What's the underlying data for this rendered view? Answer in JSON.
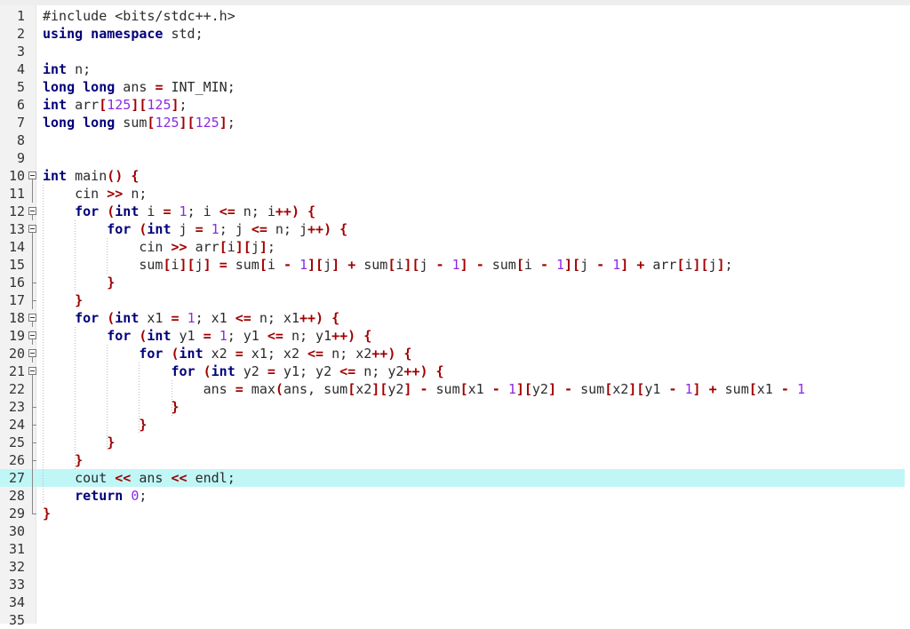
{
  "editor": {
    "highlighted_line": 27,
    "colors": {
      "keyword": "#00007a",
      "number": "#8a2be2",
      "operator": "#a00000",
      "highlight": "#c0f6f6"
    },
    "lines": [
      {
        "num": "1",
        "fold": "",
        "tokens": [
          [
            "c",
            "#include <bits/stdc++.h>"
          ]
        ]
      },
      {
        "num": "2",
        "fold": "",
        "tokens": [
          [
            "k",
            "using namespace"
          ],
          [
            "c",
            " std;"
          ]
        ]
      },
      {
        "num": "3",
        "fold": "",
        "tokens": []
      },
      {
        "num": "4",
        "fold": "",
        "tokens": [
          [
            "k",
            "int"
          ],
          [
            "c",
            " n;"
          ]
        ]
      },
      {
        "num": "5",
        "fold": "",
        "tokens": [
          [
            "k",
            "long long"
          ],
          [
            "c",
            " ans "
          ],
          [
            "p",
            "="
          ],
          [
            "c",
            " INT_MIN;"
          ]
        ]
      },
      {
        "num": "6",
        "fold": "",
        "tokens": [
          [
            "k",
            "int"
          ],
          [
            "c",
            " arr"
          ],
          [
            "p",
            "["
          ],
          [
            "n",
            "125"
          ],
          [
            "p",
            "]["
          ],
          [
            "n",
            "125"
          ],
          [
            "p",
            "]"
          ],
          [
            "c",
            ";"
          ]
        ]
      },
      {
        "num": "7",
        "fold": "",
        "tokens": [
          [
            "k",
            "long long"
          ],
          [
            "c",
            " sum"
          ],
          [
            "p",
            "["
          ],
          [
            "n",
            "125"
          ],
          [
            "p",
            "]["
          ],
          [
            "n",
            "125"
          ],
          [
            "p",
            "]"
          ],
          [
            "c",
            ";"
          ]
        ]
      },
      {
        "num": "8",
        "fold": "",
        "tokens": []
      },
      {
        "num": "9",
        "fold": "",
        "tokens": []
      },
      {
        "num": "10",
        "fold": "open",
        "tokens": [
          [
            "k",
            "int"
          ],
          [
            "c",
            " main"
          ],
          [
            "p",
            "()"
          ],
          [
            "c",
            " "
          ],
          [
            "p",
            "{"
          ]
        ]
      },
      {
        "num": "11",
        "fold": "bar",
        "tokens": [
          [
            "c",
            "    cin "
          ],
          [
            "p",
            ">>"
          ],
          [
            "c",
            " n;"
          ]
        ]
      },
      {
        "num": "12",
        "fold": "open",
        "tokens": [
          [
            "c",
            "    "
          ],
          [
            "k",
            "for"
          ],
          [
            "c",
            " "
          ],
          [
            "p",
            "("
          ],
          [
            "k",
            "int"
          ],
          [
            "c",
            " i "
          ],
          [
            "p",
            "="
          ],
          [
            "c",
            " "
          ],
          [
            "n",
            "1"
          ],
          [
            "c",
            "; i "
          ],
          [
            "p",
            "<="
          ],
          [
            "c",
            " n; i"
          ],
          [
            "p",
            "++)"
          ],
          [
            "c",
            " "
          ],
          [
            "p",
            "{"
          ]
        ]
      },
      {
        "num": "13",
        "fold": "open",
        "tokens": [
          [
            "c",
            "        "
          ],
          [
            "k",
            "for"
          ],
          [
            "c",
            " "
          ],
          [
            "p",
            "("
          ],
          [
            "k",
            "int"
          ],
          [
            "c",
            " j "
          ],
          [
            "p",
            "="
          ],
          [
            "c",
            " "
          ],
          [
            "n",
            "1"
          ],
          [
            "c",
            "; j "
          ],
          [
            "p",
            "<="
          ],
          [
            "c",
            " n; j"
          ],
          [
            "p",
            "++)"
          ],
          [
            "c",
            " "
          ],
          [
            "p",
            "{"
          ]
        ]
      },
      {
        "num": "14",
        "fold": "bar",
        "tokens": [
          [
            "c",
            "            cin "
          ],
          [
            "p",
            ">>"
          ],
          [
            "c",
            " arr"
          ],
          [
            "p",
            "["
          ],
          [
            "c",
            "i"
          ],
          [
            "p",
            "]["
          ],
          [
            "c",
            "j"
          ],
          [
            "p",
            "]"
          ],
          [
            "c",
            ";"
          ]
        ]
      },
      {
        "num": "15",
        "fold": "bar",
        "tokens": [
          [
            "c",
            "            sum"
          ],
          [
            "p",
            "["
          ],
          [
            "c",
            "i"
          ],
          [
            "p",
            "]["
          ],
          [
            "c",
            "j"
          ],
          [
            "p",
            "]"
          ],
          [
            "c",
            " "
          ],
          [
            "p",
            "="
          ],
          [
            "c",
            " sum"
          ],
          [
            "p",
            "["
          ],
          [
            "c",
            "i "
          ],
          [
            "p",
            "-"
          ],
          [
            "c",
            " "
          ],
          [
            "n",
            "1"
          ],
          [
            "p",
            "]["
          ],
          [
            "c",
            "j"
          ],
          [
            "p",
            "]"
          ],
          [
            "c",
            " "
          ],
          [
            "p",
            "+"
          ],
          [
            "c",
            " sum"
          ],
          [
            "p",
            "["
          ],
          [
            "c",
            "i"
          ],
          [
            "p",
            "]["
          ],
          [
            "c",
            "j "
          ],
          [
            "p",
            "-"
          ],
          [
            "c",
            " "
          ],
          [
            "n",
            "1"
          ],
          [
            "p",
            "]"
          ],
          [
            "c",
            " "
          ],
          [
            "p",
            "-"
          ],
          [
            "c",
            " sum"
          ],
          [
            "p",
            "["
          ],
          [
            "c",
            "i "
          ],
          [
            "p",
            "-"
          ],
          [
            "c",
            " "
          ],
          [
            "n",
            "1"
          ],
          [
            "p",
            "]["
          ],
          [
            "c",
            "j "
          ],
          [
            "p",
            "-"
          ],
          [
            "c",
            " "
          ],
          [
            "n",
            "1"
          ],
          [
            "p",
            "]"
          ],
          [
            "c",
            " "
          ],
          [
            "p",
            "+"
          ],
          [
            "c",
            " arr"
          ],
          [
            "p",
            "["
          ],
          [
            "c",
            "i"
          ],
          [
            "p",
            "]["
          ],
          [
            "c",
            "j"
          ],
          [
            "p",
            "]"
          ],
          [
            "c",
            ";"
          ]
        ]
      },
      {
        "num": "16",
        "fold": "end",
        "tokens": [
          [
            "c",
            "        "
          ],
          [
            "p",
            "}"
          ]
        ]
      },
      {
        "num": "17",
        "fold": "end",
        "tokens": [
          [
            "c",
            "    "
          ],
          [
            "p",
            "}"
          ]
        ]
      },
      {
        "num": "18",
        "fold": "open",
        "tokens": [
          [
            "c",
            "    "
          ],
          [
            "k",
            "for"
          ],
          [
            "c",
            " "
          ],
          [
            "p",
            "("
          ],
          [
            "k",
            "int"
          ],
          [
            "c",
            " x1 "
          ],
          [
            "p",
            "="
          ],
          [
            "c",
            " "
          ],
          [
            "n",
            "1"
          ],
          [
            "c",
            "; x1 "
          ],
          [
            "p",
            "<="
          ],
          [
            "c",
            " n; x1"
          ],
          [
            "p",
            "++)"
          ],
          [
            "c",
            " "
          ],
          [
            "p",
            "{"
          ]
        ]
      },
      {
        "num": "19",
        "fold": "open",
        "tokens": [
          [
            "c",
            "        "
          ],
          [
            "k",
            "for"
          ],
          [
            "c",
            " "
          ],
          [
            "p",
            "("
          ],
          [
            "k",
            "int"
          ],
          [
            "c",
            " y1 "
          ],
          [
            "p",
            "="
          ],
          [
            "c",
            " "
          ],
          [
            "n",
            "1"
          ],
          [
            "c",
            "; y1 "
          ],
          [
            "p",
            "<="
          ],
          [
            "c",
            " n; y1"
          ],
          [
            "p",
            "++)"
          ],
          [
            "c",
            " "
          ],
          [
            "p",
            "{"
          ]
        ]
      },
      {
        "num": "20",
        "fold": "open",
        "tokens": [
          [
            "c",
            "            "
          ],
          [
            "k",
            "for"
          ],
          [
            "c",
            " "
          ],
          [
            "p",
            "("
          ],
          [
            "k",
            "int"
          ],
          [
            "c",
            " x2 "
          ],
          [
            "p",
            "="
          ],
          [
            "c",
            " x1; x2 "
          ],
          [
            "p",
            "<="
          ],
          [
            "c",
            " n; x2"
          ],
          [
            "p",
            "++)"
          ],
          [
            "c",
            " "
          ],
          [
            "p",
            "{"
          ]
        ]
      },
      {
        "num": "21",
        "fold": "open",
        "tokens": [
          [
            "c",
            "                "
          ],
          [
            "k",
            "for"
          ],
          [
            "c",
            " "
          ],
          [
            "p",
            "("
          ],
          [
            "k",
            "int"
          ],
          [
            "c",
            " y2 "
          ],
          [
            "p",
            "="
          ],
          [
            "c",
            " y1; y2 "
          ],
          [
            "p",
            "<="
          ],
          [
            "c",
            " n; y2"
          ],
          [
            "p",
            "++)"
          ],
          [
            "c",
            " "
          ],
          [
            "p",
            "{"
          ]
        ]
      },
      {
        "num": "22",
        "fold": "bar",
        "tokens": [
          [
            "c",
            "                    ans "
          ],
          [
            "p",
            "="
          ],
          [
            "c",
            " max"
          ],
          [
            "p",
            "("
          ],
          [
            "c",
            "ans, sum"
          ],
          [
            "p",
            "["
          ],
          [
            "c",
            "x2"
          ],
          [
            "p",
            "]["
          ],
          [
            "c",
            "y2"
          ],
          [
            "p",
            "]"
          ],
          [
            "c",
            " "
          ],
          [
            "p",
            "-"
          ],
          [
            "c",
            " sum"
          ],
          [
            "p",
            "["
          ],
          [
            "c",
            "x1 "
          ],
          [
            "p",
            "-"
          ],
          [
            "c",
            " "
          ],
          [
            "n",
            "1"
          ],
          [
            "p",
            "]["
          ],
          [
            "c",
            "y2"
          ],
          [
            "p",
            "]"
          ],
          [
            "c",
            " "
          ],
          [
            "p",
            "-"
          ],
          [
            "c",
            " sum"
          ],
          [
            "p",
            "["
          ],
          [
            "c",
            "x2"
          ],
          [
            "p",
            "]["
          ],
          [
            "c",
            "y1 "
          ],
          [
            "p",
            "-"
          ],
          [
            "c",
            " "
          ],
          [
            "n",
            "1"
          ],
          [
            "p",
            "]"
          ],
          [
            "c",
            " "
          ],
          [
            "p",
            "+"
          ],
          [
            "c",
            " sum"
          ],
          [
            "p",
            "["
          ],
          [
            "c",
            "x1 "
          ],
          [
            "p",
            "-"
          ],
          [
            "c",
            " "
          ],
          [
            "n",
            "1"
          ]
        ]
      },
      {
        "num": "23",
        "fold": "end",
        "tokens": [
          [
            "c",
            "                "
          ],
          [
            "p",
            "}"
          ]
        ]
      },
      {
        "num": "24",
        "fold": "end",
        "tokens": [
          [
            "c",
            "            "
          ],
          [
            "p",
            "}"
          ]
        ]
      },
      {
        "num": "25",
        "fold": "end",
        "tokens": [
          [
            "c",
            "        "
          ],
          [
            "p",
            "}"
          ]
        ]
      },
      {
        "num": "26",
        "fold": "end",
        "tokens": [
          [
            "c",
            "    "
          ],
          [
            "p",
            "}"
          ]
        ]
      },
      {
        "num": "27",
        "fold": "bar",
        "tokens": [
          [
            "c",
            "    cout "
          ],
          [
            "p",
            "<<"
          ],
          [
            "c",
            " ans "
          ],
          [
            "p",
            "<<"
          ],
          [
            "c",
            " endl;"
          ]
        ]
      },
      {
        "num": "28",
        "fold": "bar",
        "tokens": [
          [
            "c",
            "    "
          ],
          [
            "k",
            "return"
          ],
          [
            "c",
            " "
          ],
          [
            "n",
            "0"
          ],
          [
            "c",
            ";"
          ]
        ]
      },
      {
        "num": "29",
        "fold": "close",
        "tokens": [
          [
            "p",
            "}"
          ]
        ]
      },
      {
        "num": "30",
        "fold": "",
        "tokens": []
      },
      {
        "num": "31",
        "fold": "",
        "tokens": []
      },
      {
        "num": "32",
        "fold": "",
        "tokens": []
      },
      {
        "num": "33",
        "fold": "",
        "tokens": []
      },
      {
        "num": "34",
        "fold": "",
        "tokens": []
      },
      {
        "num": "35",
        "fold": "",
        "tokens": []
      }
    ]
  }
}
